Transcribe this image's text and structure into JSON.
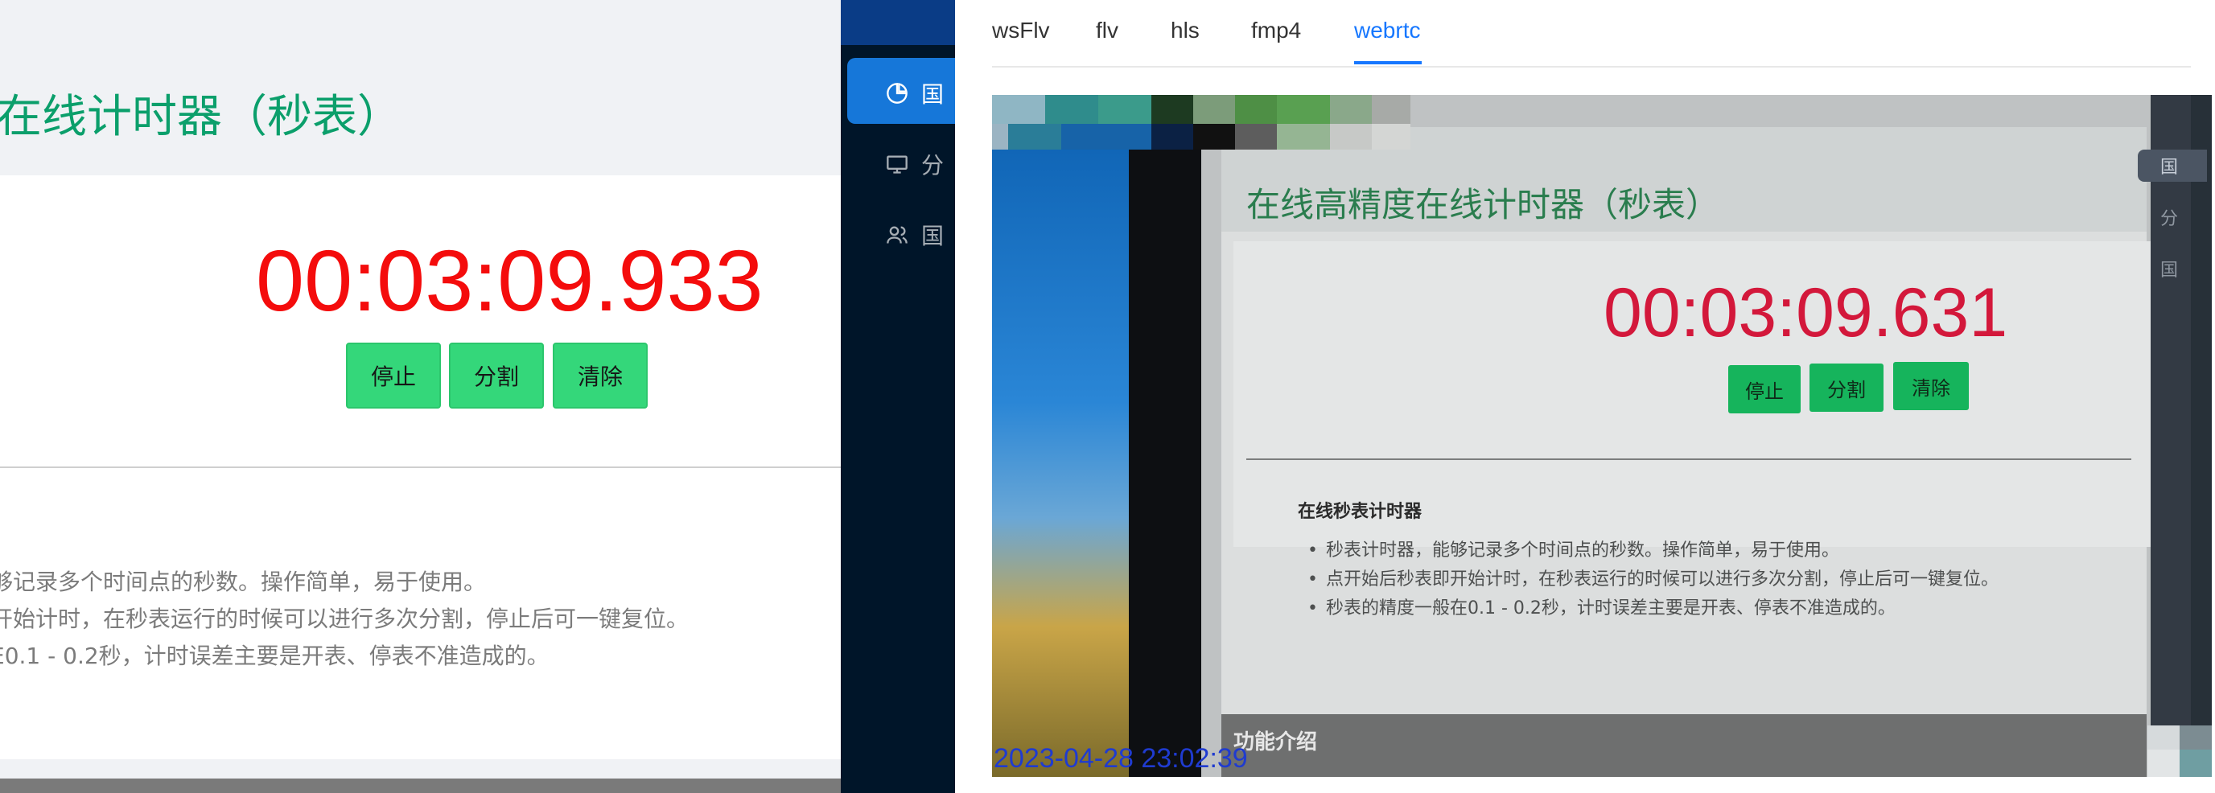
{
  "left_page": {
    "title": "在线计时器（秒表）",
    "timer": "00:03:09.933",
    "buttons": {
      "stop": "停止",
      "split": "分割",
      "clear": "清除"
    },
    "lines": [
      "够记录多个时间点的秒数。操作简单，易于使用。",
      "开始计时，在秒表运行的时候可以进行多次分割，停止后可一键复位。",
      "E0.1 - 0.2秒，计时误差主要是开表、停表不准造成的。"
    ]
  },
  "sidebar": {
    "items": [
      {
        "label": "国",
        "icon": "pie-chart-icon",
        "active": true
      },
      {
        "label": "分",
        "icon": "monitor-icon",
        "active": false
      },
      {
        "label": "国",
        "icon": "users-icon",
        "active": false
      }
    ]
  },
  "stream_tabs": {
    "items": [
      "wsFlv",
      "flv",
      "hls",
      "fmp4",
      "webrtc"
    ],
    "selected": "webrtc"
  },
  "video": {
    "page_title": "在线高精度在线计时器（秒表）",
    "timer": "00:03:09.631",
    "buttons": {
      "stop": "停止",
      "split": "分割",
      "clear": "清除"
    },
    "section_heading": "在线秒表计时器",
    "list": [
      "秒表计时器，能够记录多个时间点的秒数。操作简单，易于使用。",
      "点开始后秒表即开始计时，在秒表运行的时候可以进行多次分割，停止后可一键复位。",
      "秒表的精度一般在0.1 - 0.2秒，计时误差主要是开表、停表不准造成的。"
    ],
    "footer": "功能介绍",
    "timestamp": "2023-04-28 23:02:39",
    "side_labels": [
      "国",
      "分",
      "国"
    ]
  },
  "colors": {
    "title_green": "#0b9f6b",
    "timer_red": "#f40c0c",
    "button_green": "#34d77a",
    "tab_active": "#1677ff",
    "sidebar_bg": "#001529",
    "sidebar_active": "#1677d9"
  }
}
